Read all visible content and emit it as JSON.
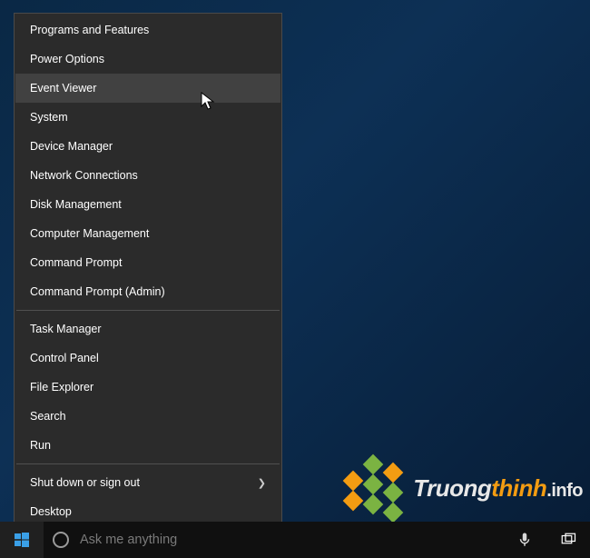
{
  "menu": {
    "groups": [
      [
        {
          "id": "programs-features",
          "label": "Programs and Features",
          "hover": false,
          "submenu": false
        },
        {
          "id": "power-options",
          "label": "Power Options",
          "hover": false,
          "submenu": false
        },
        {
          "id": "event-viewer",
          "label": "Event Viewer",
          "hover": true,
          "submenu": false
        },
        {
          "id": "system",
          "label": "System",
          "hover": false,
          "submenu": false
        },
        {
          "id": "device-manager",
          "label": "Device Manager",
          "hover": false,
          "submenu": false
        },
        {
          "id": "network-connections",
          "label": "Network Connections",
          "hover": false,
          "submenu": false
        },
        {
          "id": "disk-management",
          "label": "Disk Management",
          "hover": false,
          "submenu": false
        },
        {
          "id": "computer-management",
          "label": "Computer Management",
          "hover": false,
          "submenu": false
        },
        {
          "id": "command-prompt",
          "label": "Command Prompt",
          "hover": false,
          "submenu": false
        },
        {
          "id": "command-prompt-admin",
          "label": "Command Prompt (Admin)",
          "hover": false,
          "submenu": false
        }
      ],
      [
        {
          "id": "task-manager",
          "label": "Task Manager",
          "hover": false,
          "submenu": false
        },
        {
          "id": "control-panel",
          "label": "Control Panel",
          "hover": false,
          "submenu": false
        },
        {
          "id": "file-explorer",
          "label": "File Explorer",
          "hover": false,
          "submenu": false
        },
        {
          "id": "search",
          "label": "Search",
          "hover": false,
          "submenu": false
        },
        {
          "id": "run",
          "label": "Run",
          "hover": false,
          "submenu": false
        }
      ],
      [
        {
          "id": "shut-down-sign-out",
          "label": "Shut down or sign out",
          "hover": false,
          "submenu": true
        },
        {
          "id": "desktop",
          "label": "Desktop",
          "hover": false,
          "submenu": false
        }
      ]
    ]
  },
  "taskbar": {
    "search_placeholder": "Ask me anything"
  },
  "watermark": {
    "text_pre": "Truong",
    "text_hl": "thinh",
    "text_post": ".info"
  }
}
